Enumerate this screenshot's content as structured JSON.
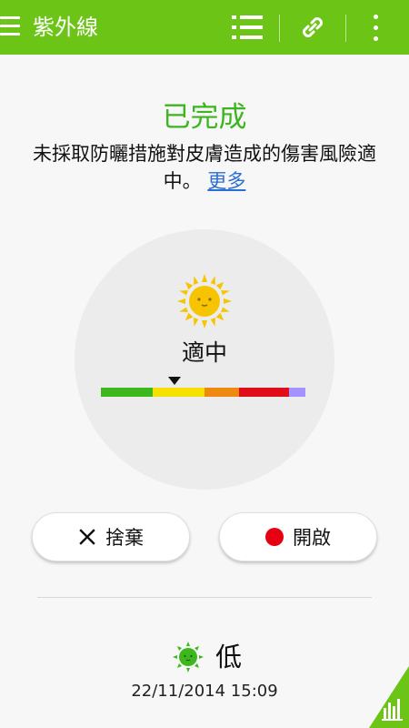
{
  "header": {
    "title": "紫外線",
    "menu_icon": "hamburger-menu-icon",
    "list_icon": "list-icon",
    "link_icon": "link-icon",
    "more_icon": "overflow-menu-icon",
    "bar_color": "#6cc417"
  },
  "status": {
    "title": "已完成",
    "description": "未採取防曬措施對皮膚造成的傷害風險適中。",
    "more_link": "更多",
    "title_color": "#3db51f",
    "link_color": "#2b6fd6"
  },
  "uv_meter": {
    "level_label": "適中",
    "icon": "sun-face-icon",
    "scale_colors": [
      "#3cb81e",
      "#f5e000",
      "#ee8a12",
      "#e00e18",
      "#a493ff"
    ],
    "scale_segments": [
      0.255,
      0.255,
      0.17,
      0.25,
      0.08
    ],
    "indicator_fraction": 0.36
  },
  "buttons": {
    "discard_label": "捨棄",
    "open_label": "開啟",
    "discard_icon": "close-icon",
    "open_icon": "record-dot-icon"
  },
  "last_measurement": {
    "level": "低",
    "icon": "green-sun-face-icon",
    "timestamp": "22/11/2014 15:09"
  },
  "history_button": {
    "icon": "bar-chart-icon",
    "color": "#6cc417"
  }
}
